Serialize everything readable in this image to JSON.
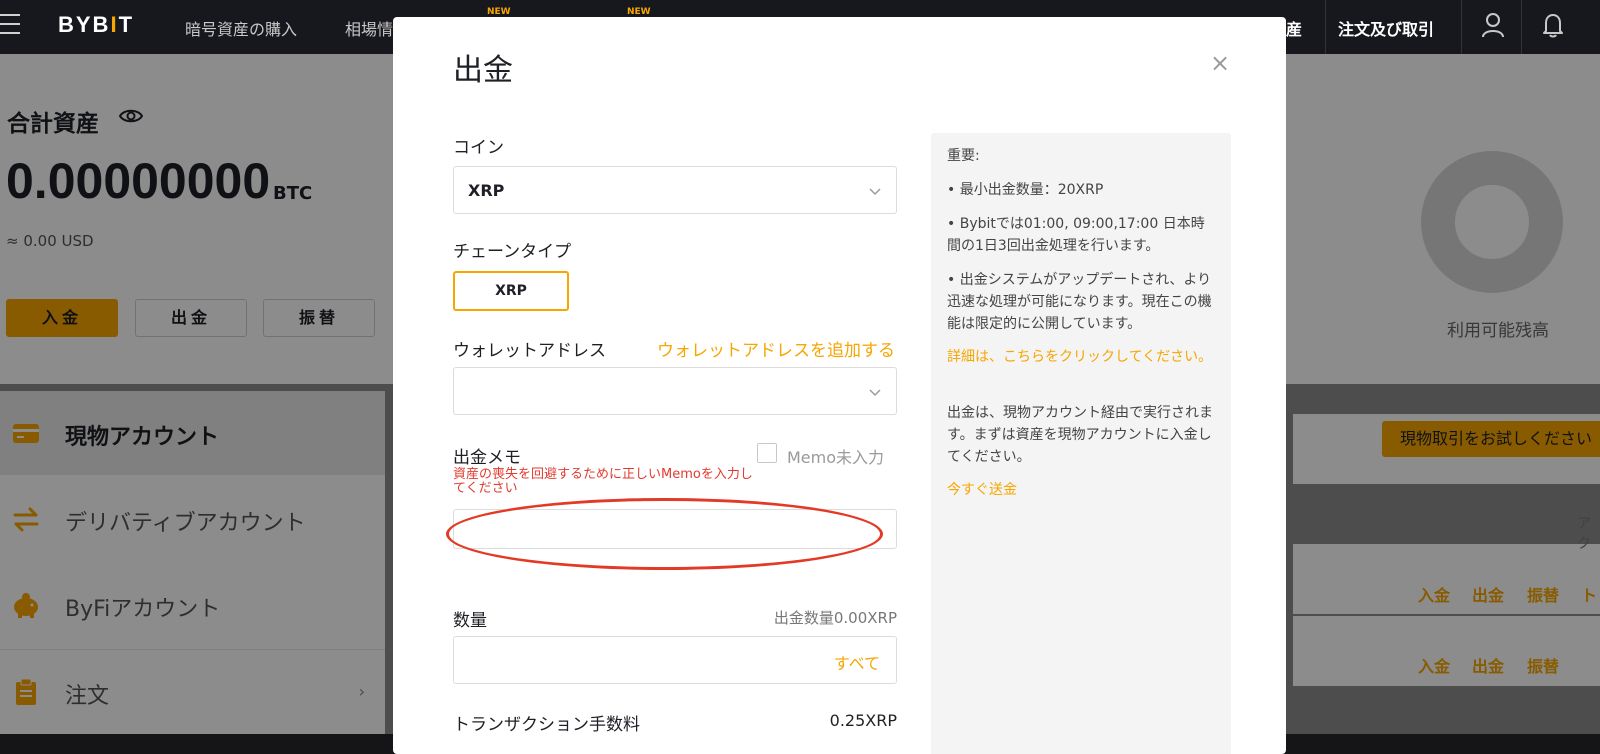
{
  "header": {
    "logo_left": "BYB",
    "logo_i": "I",
    "logo_right": "T",
    "nav": [
      {
        "label": "暗号資産の購入"
      },
      {
        "label": "相場情"
      }
    ],
    "new_badge": "NEW",
    "nav_right_partial": "産",
    "orders_label": "注文及び取引",
    "icons": [
      "menu-icon",
      "user-icon",
      "bell-icon"
    ]
  },
  "overview": {
    "title": "合計資産",
    "btc_amount": "0.00000000",
    "btc_unit": "BTC",
    "usd_amount": "≈ 0.00 USD",
    "deposit_label": "入金",
    "withdraw_label": "出金",
    "transfer_label": "振替"
  },
  "sidebar": {
    "items": [
      {
        "label": "現物アカウント",
        "icon": "wallet-card-icon"
      },
      {
        "label": "デリバティブアカウント",
        "icon": "swap-arrows-icon"
      },
      {
        "label": "ByFiアカウント",
        "icon": "piggy-bank-icon"
      },
      {
        "label": "注文",
        "icon": "clipboard-icon"
      }
    ],
    "chevron": "›"
  },
  "right_panel": {
    "available_label": "利用可能残高",
    "try_spot_label": "現物取引をお試しください",
    "column_head": "アク",
    "row1": {
      "deposit": "入金",
      "withdraw": "出金",
      "transfer": "振替",
      "trade": "ト"
    },
    "row2": {
      "deposit": "入金",
      "withdraw": "出金",
      "transfer": "振替"
    }
  },
  "modal": {
    "title": "出金",
    "close_glyph": "×",
    "coin_label": "コイン",
    "coin_value": "XRP",
    "chain_label": "チェーンタイプ",
    "chain_value": "XRP",
    "wallet_label": "ウォレットアドレス",
    "wallet_add_link": "ウォレットアドレスを追加する",
    "wallet_value": "",
    "memo_label": "出金メモ",
    "memo_checkbox_label": "Memo未入力",
    "memo_warning": "資産の喪失を回避するために正しいMemoを入力してください",
    "memo_value": "",
    "amount_label": "数量",
    "amount_hint": "出金数量0.00XRP",
    "amount_value": "",
    "all_label": "すべて",
    "fee_label": "トランザクション手数料",
    "fee_value": "0.25XRP",
    "info": {
      "heading": "重要:",
      "bullet1": "• 最小出金数量：20XRP",
      "bullet2": "• Bybitでは01:00, 09:00,17:00 日本時間の1日3回出金処理を行います。",
      "bullet3": "• 出金システムがアップデートされ、より迅速な処理が可能になります。現在この機能は限定的に公開しています。",
      "details_link": "詳細は、こちらをクリックしてください。",
      "note": "出金は、現物アカウント経由で実行されます。まずは資産を現物アカウントに入金してください。",
      "send_now_link": "今すぐ送金"
    }
  },
  "colors": {
    "accent": "#f7a600",
    "warning": "#e23a2f",
    "annotation": "#e33a26",
    "topbar": "#17181e"
  }
}
